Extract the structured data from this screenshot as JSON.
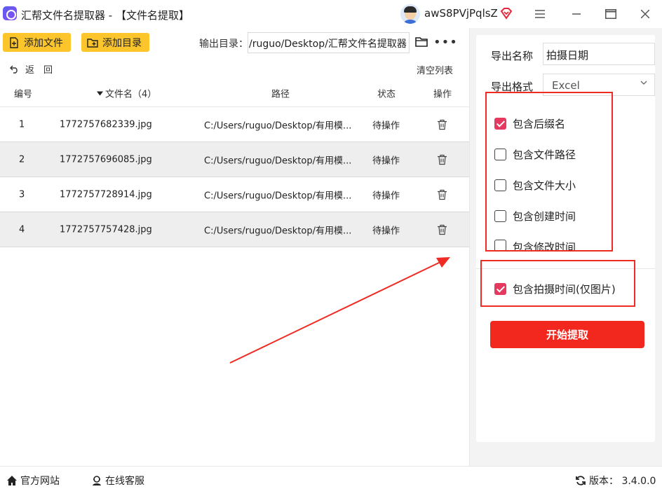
{
  "window": {
    "title": "汇帮文件名提取器 - 【文件名提取】",
    "username": "awS8PVjPqlsZ"
  },
  "toolbar": {
    "add_file": "添加文件",
    "add_dir": "添加目录",
    "output_label": "输出目录：",
    "output_path": "/ruguo/Desktop/汇帮文件名提取器",
    "back": "返　回",
    "clear_list": "清空列表"
  },
  "table": {
    "headers": {
      "index": "编号",
      "filename": "文件名（4）",
      "path": "路径",
      "status": "状态",
      "action": "操作"
    },
    "rows": [
      {
        "index": "1",
        "filename": "1772757682339.jpg",
        "path": "C:/Users/ruguo/Desktop/有用模...",
        "status": "待操作"
      },
      {
        "index": "2",
        "filename": "1772757696085.jpg",
        "path": "C:/Users/ruguo/Desktop/有用模...",
        "status": "待操作"
      },
      {
        "index": "3",
        "filename": "1772757728914.jpg",
        "path": "C:/Users/ruguo/Desktop/有用模...",
        "status": "待操作"
      },
      {
        "index": "4",
        "filename": "1772757757428.jpg",
        "path": "C:/Users/ruguo/Desktop/有用模...",
        "status": "待操作"
      }
    ]
  },
  "options": {
    "export_name_label": "导出名称",
    "export_name_value": "拍摄日期",
    "export_format_label": "导出格式",
    "export_format_value": "Excel",
    "checkboxes": [
      {
        "label": "包含后缀名",
        "checked": true
      },
      {
        "label": "包含文件路径",
        "checked": false
      },
      {
        "label": "包含文件大小",
        "checked": false
      },
      {
        "label": "包含创建时间",
        "checked": false
      },
      {
        "label": "包含修改时间",
        "checked": false
      },
      {
        "label": "包含拍摄时间(仅图片)",
        "checked": true
      }
    ],
    "start_button": "开始提取"
  },
  "footer": {
    "website": "官方网站",
    "support": "在线客服",
    "version": "版本：  3.4.0.0"
  },
  "colors": {
    "accent_yellow": "#fcc52b",
    "start_red": "#f2281f",
    "checkbox_pink": "#e53960",
    "annotation_red": "#ef2b23"
  }
}
